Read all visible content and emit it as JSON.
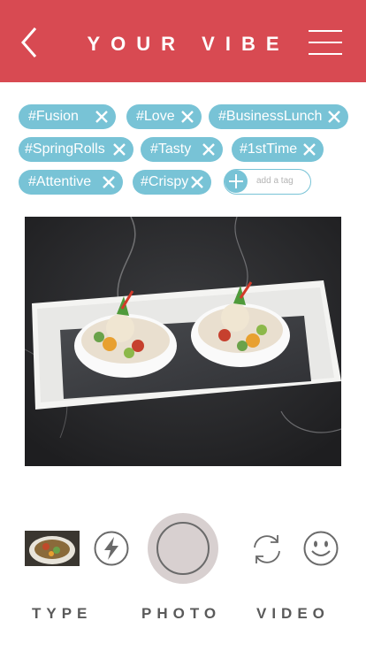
{
  "header": {
    "title": "YOUR VIBE",
    "color": "#d84a52"
  },
  "tags": [
    {
      "label": "#Fusion"
    },
    {
      "label": "#Love"
    },
    {
      "label": "#BusinessLunch"
    },
    {
      "label": "#SpringRolls"
    },
    {
      "label": "#Tasty"
    },
    {
      "label": "#1stTime"
    },
    {
      "label": "#Attentive"
    },
    {
      "label": "#Crispy"
    }
  ],
  "tag_color": "#78c3d6",
  "add_tag": {
    "placeholder": "add a tag"
  },
  "photo": {
    "description_icon": "food-photo"
  },
  "controls": {
    "flash_icon": "flash-icon",
    "switch_icon": "switch-camera-icon",
    "emoji_icon": "smiley-icon"
  },
  "modes": {
    "type": "TYPE",
    "photo": "PHOTO",
    "video": "VIDEO"
  }
}
